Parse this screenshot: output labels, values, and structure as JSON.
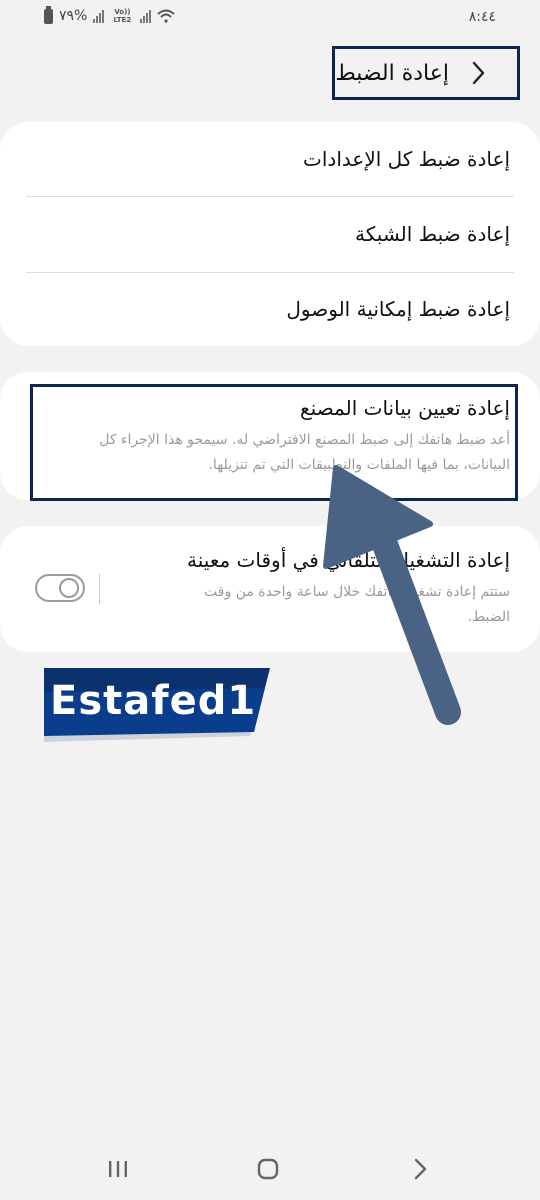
{
  "status": {
    "time": "٨:٤٤",
    "battery_text": "%٧٩",
    "volte": "Vo)) LTE2",
    "icons": [
      "battery-icon",
      "signal-icon",
      "volte-icon",
      "wifi-icon"
    ]
  },
  "header": {
    "title": "إعادة الضبط",
    "back_icon": "chevron-right-icon"
  },
  "reset_group": {
    "items": [
      {
        "label": "إعادة ضبط كل الإعدادات"
      },
      {
        "label": "إعادة ضبط الشبكة"
      },
      {
        "label": "إعادة ضبط إمكانية الوصول"
      }
    ]
  },
  "factory_reset": {
    "title": "إعادة تعيين بيانات المصنع",
    "description_line1": "أعد ضبط هاتفك إلى ضبط المصنع الافتراضي له. سيمحو هذا الإجراء كل",
    "description_line2": "البيانات، بما فيها الملفات والتطبيقات التي تم تنزيلها."
  },
  "auto_restart": {
    "title": "إعادة التشغيل التلقائي في أوقات معينة",
    "description_line1": "ستتم إعادة تشغيل هاتفك خلال ساعة واحدة من وقت",
    "description_line2": "الضبط.",
    "toggle_on": false
  },
  "watermark": {
    "text": "Estafed1"
  },
  "nav_bar": {
    "icons": [
      "recent-apps-icon",
      "home-icon",
      "back-icon"
    ]
  },
  "colors": {
    "background": "#f2f2f2",
    "card": "#ffffff",
    "highlight_border": "#0b2650",
    "arrow": "#4a6384",
    "description": "#9a9a9a",
    "watermark_bg": "#0a3d8c"
  }
}
